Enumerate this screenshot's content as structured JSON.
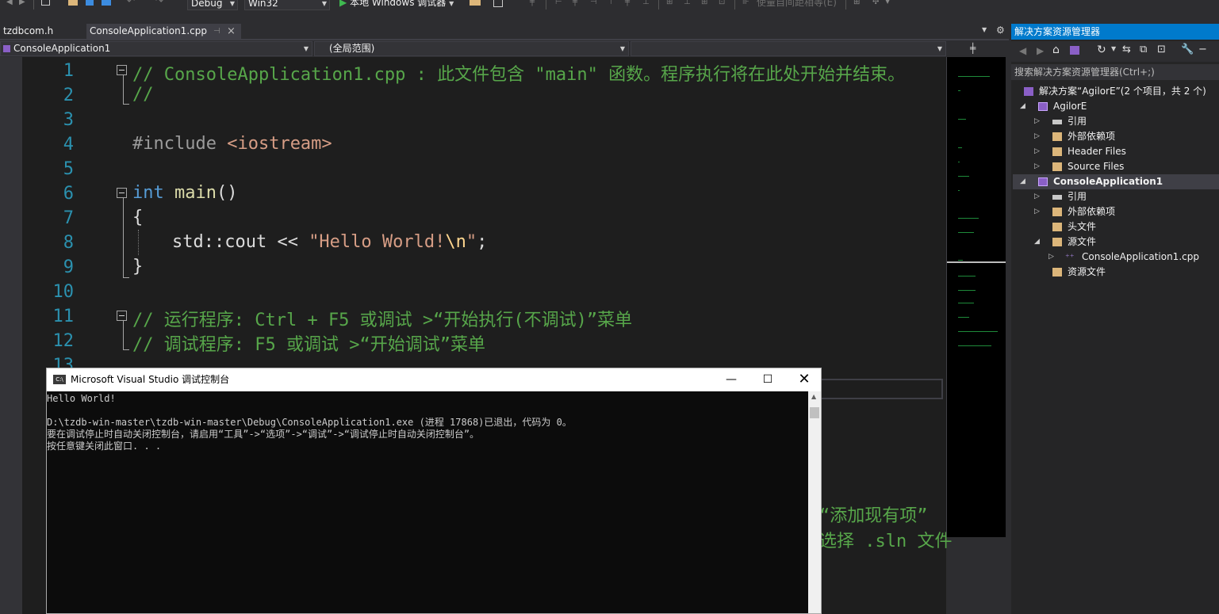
{
  "toolbar": {
    "config": "Debug",
    "platform": "Win32",
    "run_label": "本地 Windows 调试器",
    "hint": "使量自间距相等(E)"
  },
  "tabs": [
    {
      "label": "tzdbcom.h"
    },
    {
      "label": "ConsoleApplication1.cpp"
    }
  ],
  "navbar": {
    "project": "ConsoleApplication1",
    "scope": "(全局范围)"
  },
  "editor": {
    "line_numbers": [
      "1",
      "2",
      "3",
      "4",
      "5",
      "6",
      "7",
      "8",
      "9",
      "10",
      "11",
      "12",
      "13"
    ],
    "line1": "// ConsoleApplication1.cpp : 此文件包含 \"main\" 函数。程序执行将在此处开始并结束。",
    "line2": "//",
    "line4_directive": "#include",
    "line4_header": "<iostream>",
    "line6_kw": "int",
    "line6_fn": "main",
    "line6_rest": "()",
    "line7": "{",
    "line8_pre": "std::cout << ",
    "line8_str": "\"Hello World!",
    "line8_esc": "\\n",
    "line8_end": "\"",
    "line8_semi": ";",
    "line9": "}",
    "line11": "// 运行程序: Ctrl + F5 或调试 >“开始执行(不调试)”菜单",
    "line12": "// 调试程序: F5 或调试 >“开始调试”菜单",
    "hidden_frag1": "“添加现有项”",
    "hidden_frag2": "选择 .sln 文件"
  },
  "solution_explorer": {
    "title": "解决方案资源管理器",
    "search_placeholder": "搜索解决方案资源管理器(Ctrl+;)",
    "items": [
      {
        "label": "解决方案“AgilorE”(2 个项目，共 2 个)"
      },
      {
        "label": "AgilorE"
      },
      {
        "label": "引用"
      },
      {
        "label": "外部依赖项"
      },
      {
        "label": "Header Files"
      },
      {
        "label": "Source Files"
      },
      {
        "label": "ConsoleApplication1"
      },
      {
        "label": "引用"
      },
      {
        "label": "外部依赖项"
      },
      {
        "label": "头文件"
      },
      {
        "label": "源文件"
      },
      {
        "label": "ConsoleApplication1.cpp"
      },
      {
        "label": "资源文件"
      }
    ]
  },
  "console": {
    "title": "Microsoft Visual Studio 调试控制台",
    "icon_text": "C:\\",
    "lines": [
      "Hello World!",
      "",
      "D:\\tzdb-win-master\\tzdb-win-master\\Debug\\ConsoleApplication1.exe (进程 17868)已退出，代码为 0。",
      "要在调试停止时自动关闭控制台，请启用“工具”->“选项”->“调试”->“调试停止时自动关闭控制台”。",
      "按任意键关闭此窗口. . ."
    ]
  },
  "colors": {
    "accent": "#007acc",
    "comment": "#57a64a",
    "keyword": "#569cd6",
    "line_number": "#2b91af",
    "string": "#d69d85"
  }
}
